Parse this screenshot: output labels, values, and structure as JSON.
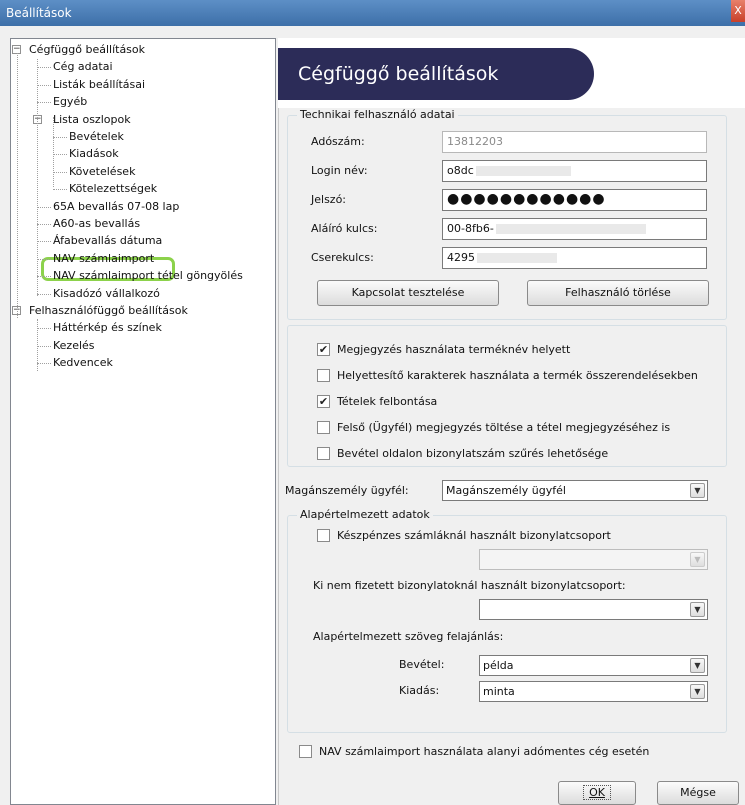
{
  "window": {
    "title": "Beállítások",
    "close_label": "X"
  },
  "tree": {
    "items": [
      {
        "id": "cegfuggo",
        "label": "Cégfüggő beállítások",
        "level": 0,
        "expanded": true
      },
      {
        "id": "ceg-adatai",
        "label": "Cég adatai",
        "level": 1
      },
      {
        "id": "listak",
        "label": "Listák beállításai",
        "level": 1
      },
      {
        "id": "egyeb",
        "label": "Egyéb",
        "level": 1
      },
      {
        "id": "lista-oszlopok",
        "label": "Lista oszlopok",
        "level": 1,
        "expanded": true
      },
      {
        "id": "bevetelek",
        "label": "Bevételek",
        "level": 2
      },
      {
        "id": "kiadasok",
        "label": "Kiadások",
        "level": 2
      },
      {
        "id": "kovetelesek",
        "label": "Követelések",
        "level": 2
      },
      {
        "id": "kotelezettsegek",
        "label": "Kötelezettségek",
        "level": 2
      },
      {
        "id": "65a",
        "label": "65A bevallás 07-08 lap",
        "level": 1
      },
      {
        "id": "a60",
        "label": "A60-as bevallás",
        "level": 1
      },
      {
        "id": "afa",
        "label": "Áfabevallás dátuma",
        "level": 1
      },
      {
        "id": "nav-szamlaimport",
        "label": "NAV számlaimport",
        "level": 1,
        "highlighted": true
      },
      {
        "id": "nav-gongyoles",
        "label": "NAV számlaimport tétel göngyölés",
        "level": 1
      },
      {
        "id": "kisadozo",
        "label": "Kisadózó vállalkozó",
        "level": 1
      },
      {
        "id": "felhasznalofuggo",
        "label": "Felhasználófüggő beállítások",
        "level": 0,
        "expanded": true
      },
      {
        "id": "hatterkep",
        "label": "Háttérkép és színek",
        "level": 1
      },
      {
        "id": "kezeles",
        "label": "Kezelés",
        "level": 1
      },
      {
        "id": "kedvencek",
        "label": "Kedvencek",
        "level": 1
      }
    ],
    "highlight_color": "#8cd24b"
  },
  "panel": {
    "title": "Cégfüggő beállítások",
    "technical_user": {
      "legend": "Technikai felhasználó adatai",
      "fields": [
        {
          "id": "adoszam",
          "label": "Adószám:",
          "value": "13812203",
          "readonly": true
        },
        {
          "id": "login",
          "label": "Login név:",
          "value": "o8dc"
        },
        {
          "id": "jelszo",
          "label": "Jelszó:",
          "value": "●●●●●●●●●●●●",
          "password": true
        },
        {
          "id": "alairo",
          "label": "Aláíró kulcs:",
          "value": "00-8fb6-"
        },
        {
          "id": "csere",
          "label": "Cserekulcs:",
          "value": "4295"
        }
      ],
      "test_button": "Kapcsolat tesztelése",
      "delete_button": "Felhasználó törlése"
    },
    "options": [
      {
        "id": "megjegyzes",
        "label": "Megjegyzés használata terméknév helyett",
        "checked": true
      },
      {
        "id": "helyettesito",
        "label": "Helyettesítő karakterek használata a termék összerendelésekben",
        "checked": false
      },
      {
        "id": "felbontas",
        "label": "Tételek felbontása",
        "checked": true
      },
      {
        "id": "felso",
        "label": "Felső (Ügyfél) megjegyzés töltése a tétel megjegyzéséhez is",
        "checked": false
      },
      {
        "id": "bevetel-szures",
        "label": "Bevétel oldalon bizonylatszám szűrés lehetősége",
        "checked": false
      }
    ],
    "maganszemely": {
      "label": "Magánszemély ügyfél:",
      "value": "Magánszemély ügyfél"
    },
    "defaults": {
      "legend": "Alapértelmezett adatok",
      "keszpenz_label": "Készpénzes számláknál használt bizonylatcsoport",
      "keszpenz_checked": false,
      "keszpenz_value": "",
      "ki_nem_label": "Ki nem fizetett bizonylatoknál használt bizonylatcsoport:",
      "ki_nem_value": "",
      "szoveg_label": "Alapértelmezett szöveg felajánlás:",
      "bevetel_label": "Bevétel:",
      "bevetel_value": "példa",
      "kiadas_label": "Kiadás:",
      "kiadas_value": "minta"
    },
    "nav_alanyi": {
      "label": "NAV számlaimport használata alanyi adómentes cég esetén",
      "checked": false
    },
    "ok_button": "OK",
    "cancel_button": "Mégse"
  },
  "colors": {
    "titlebar": "#4a7db8",
    "banner": "#2c2c58",
    "highlight": "#8cd24b"
  }
}
